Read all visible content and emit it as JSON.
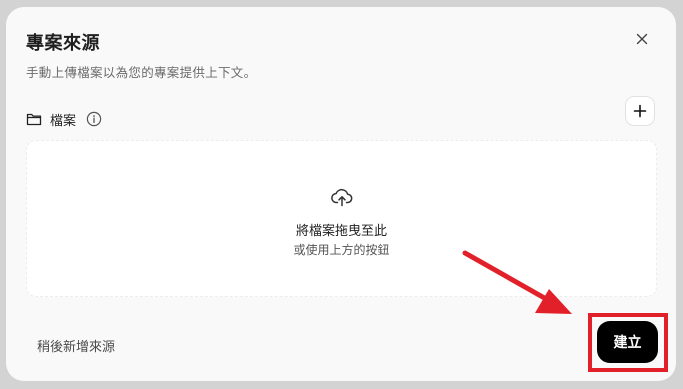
{
  "dialog": {
    "title": "專案來源",
    "subtitle": "手動上傳檔案以為您的專案提供上下文。",
    "close_icon": "close-icon"
  },
  "files_section": {
    "label": "檔案",
    "folder_icon": "folder-icon",
    "info_icon": "info-icon",
    "add_icon": "plus-icon"
  },
  "dropzone": {
    "icon": "cloud-upload-icon",
    "title": "將檔案拖曳至此",
    "subtitle": "或使用上方的按鈕"
  },
  "footer": {
    "later_label": "稍後新增來源",
    "create_label": "建立"
  },
  "annotation": {
    "color": "#e2202a"
  }
}
